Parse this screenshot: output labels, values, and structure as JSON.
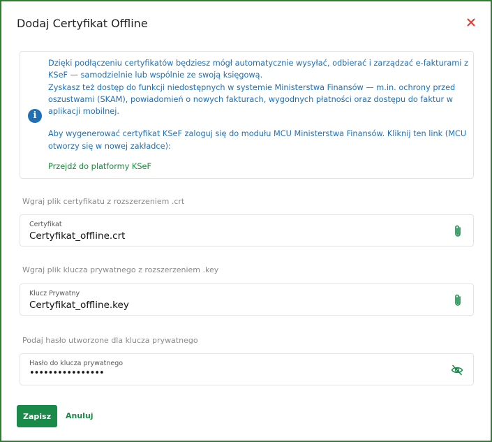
{
  "dialog": {
    "title": "Dodaj Certyfikat Offline",
    "close_icon": "close-icon",
    "accent_color": "#1a8a4a",
    "close_color": "#e53935"
  },
  "info": {
    "icon": "info-icon",
    "line1": "Dzięki podłączeniu certyfikatów będziesz mógł automatycznie wysyłać, odbierać i zarządzać e-fakturami z KSeF — samodzielnie lub wspólnie ze swoją księgową.",
    "line2": "Zyskasz też dostęp do funkcji niedostępnych w systemie Ministerstwa Finansów — m.in. ochrony przed oszustwami (SKAM), powiadomień o nowych fakturach, wygodnych płatności oraz dostępu do faktur w aplikacji mobilnej.",
    "line3": "Aby wygenerować certyfikat KSeF zaloguj się do modułu MCU Ministerstwa Finansów. Kliknij ten link (MCU otworzy się w nowej zakładce):",
    "link": "Przejdź do platformy KSeF",
    "text_color": "#1f6fb4"
  },
  "certificate": {
    "section_label": "Wgraj plik certyfikatu z rozszerzeniem .crt",
    "field_label": "Certyfikat",
    "value": "Certyfikat_offline.crt",
    "icon": "paperclip-icon"
  },
  "private_key": {
    "section_label": "Wgraj plik klucza prywatnego z rozszerzeniem .key",
    "field_label": "Klucz Prywatny",
    "value": "Certyfikat_offline.key",
    "icon": "paperclip-icon"
  },
  "password": {
    "section_label": "Podaj hasło utworzone dla klucza prywatnego",
    "field_label": "Hasło do klucza prywatnego",
    "value": "••••••••••••••••",
    "icon": "eye-off-icon"
  },
  "actions": {
    "save_label": "Zapisz",
    "cancel_label": "Anuluj"
  }
}
